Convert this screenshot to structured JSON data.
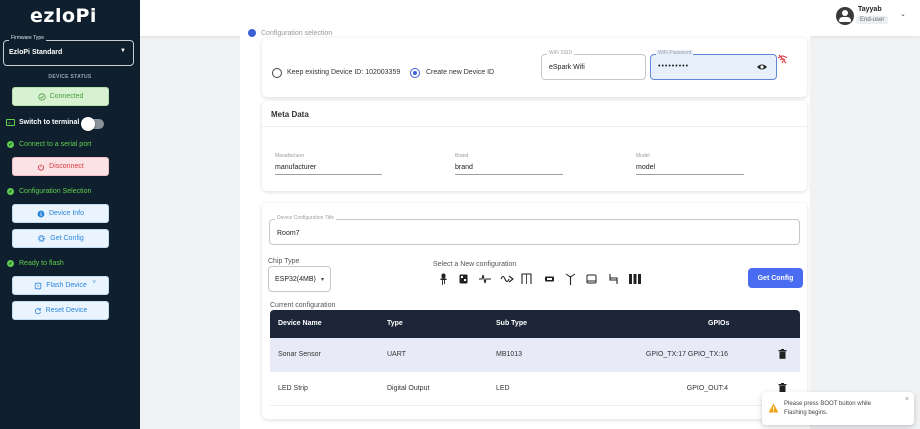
{
  "sidebar": {
    "logo": "ezloPi",
    "firmware_legend": "Firmware Type",
    "firmware_value": "EzloPi Standard",
    "device_status_label": "DEVICE STATUS",
    "connected_label": "Connected",
    "switch_terminal_label": "Switch to terminal",
    "connect_serial_label": "Connect to a serial port",
    "disconnect_label": "Disconnect",
    "config_selection_label": "Configuration Selection",
    "device_info_label": "Device Info",
    "get_config_label": "Get Config",
    "ready_flash_label": "Ready to flash",
    "flash_device_label": "Flash Device",
    "reset_device_label": "Reset Device",
    "terminal_on": false
  },
  "header": {
    "user_name": "Tayyab",
    "user_role": "End-user"
  },
  "config": {
    "section_title": "Configuration selection",
    "keep_existing_label": "Keep existing Device ID: 102003359",
    "create_new_label": "Create new Device ID",
    "wifi_ssid_legend": "WiFi SSID",
    "wifi_ssid_value": "eSpark Wifi",
    "wifi_password_legend": "WiFi Password",
    "wifi_password_value": "•••••••••"
  },
  "meta": {
    "title": "Meta Data",
    "manufacturer_label": "Manufacturer",
    "manufacturer_value": "manufacturer",
    "brand_label": "Brand",
    "brand_value": "brand",
    "model_label": "Model",
    "model_value": "model"
  },
  "device_config": {
    "title_legend": "Device Configuration Title",
    "title_value": "Room7",
    "chip_type_label": "Chip Type",
    "chip_type_value": "ESP32(4MB)",
    "select_new_label": "Select a New configuration",
    "get_config_button": "Get Config",
    "current_config_label": "Current configuration",
    "columns": [
      "Device Name",
      "Type",
      "Sub Type",
      "GPIOs"
    ],
    "rows": [
      {
        "name": "Sonar Sensor",
        "type": "UART",
        "subtype": "MB1013",
        "gpios": "GPIO_TX:17 GPIO_TX:16"
      },
      {
        "name": "LED Strip",
        "type": "Digital Output",
        "subtype": "LED",
        "gpios": "GPIO_OUT:4"
      }
    ]
  },
  "toast": {
    "message": "Please press BOOT button while Flashing begins."
  },
  "colors": {
    "sidebar_bg": "#0f1f2e",
    "accent": "#4a6cf0",
    "success": "#5fcf4e",
    "danger": "#d33a44",
    "table_header": "#1c2638"
  }
}
